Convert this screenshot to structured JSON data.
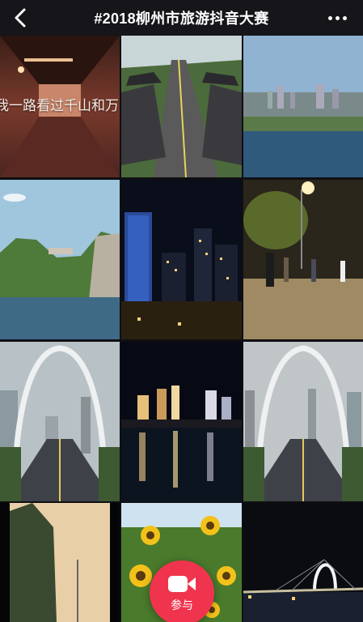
{
  "header": {
    "title": "#2018柳州市旅游抖音大赛",
    "back_icon": "chevron-left-icon",
    "more_icon": "more-dots-icon"
  },
  "videos": [
    {
      "scene": "tunnel",
      "caption": "我一路看过千山和万水"
    },
    {
      "scene": "drum-tower-road"
    },
    {
      "scene": "city-lake"
    },
    {
      "scene": "karst-river"
    },
    {
      "scene": "night-skyscrapers"
    },
    {
      "scene": "evening-street-walk"
    },
    {
      "scene": "arch-bridge-left"
    },
    {
      "scene": "night-river-reflection"
    },
    {
      "scene": "arch-bridge-right"
    },
    {
      "scene": "rock-cliff"
    },
    {
      "scene": "sunflowers"
    },
    {
      "scene": "night-bridge"
    }
  ],
  "join_button": {
    "label": "参与",
    "icon": "video-camera-icon",
    "color": "#f0344e"
  }
}
